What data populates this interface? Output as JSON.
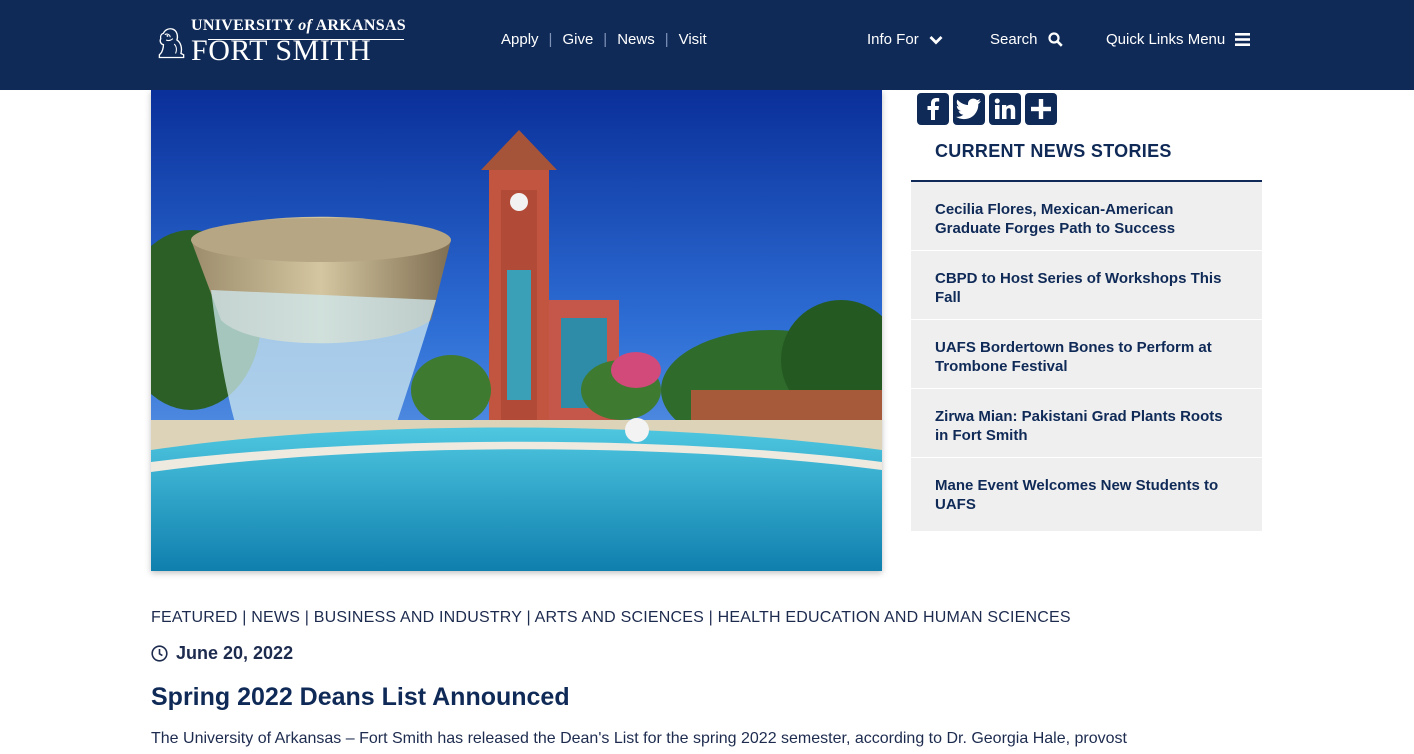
{
  "header": {
    "logo": {
      "line1_a": "UNIVERSITY",
      "line1_b": "of",
      "line1_c": "ARKANSAS",
      "line2": "FORT SMITH"
    },
    "nav": [
      {
        "label": "Apply"
      },
      {
        "label": "Give"
      },
      {
        "label": "News"
      },
      {
        "label": "Visit"
      }
    ],
    "info_for": "Info For",
    "search": "Search",
    "quick_links": "Quick Links Menu"
  },
  "share": [
    "facebook-icon",
    "twitter-icon",
    "linkedin-icon",
    "share-icon"
  ],
  "sidebar": {
    "title": "CURRENT NEWS STORIES",
    "items": [
      {
        "label": "Cecilia Flores, Mexican-American Graduate Forges Path to Success"
      },
      {
        "label": "CBPD to Host Series of Workshops This Fall"
      },
      {
        "label": "UAFS Bordertown Bones to Perform at Trombone Festival"
      },
      {
        "label": "Zirwa Mian: Pakistani Grad Plants Roots in Fort Smith"
      },
      {
        "label": "Mane Event Welcomes New Students to UAFS"
      }
    ]
  },
  "article": {
    "categories": "FEATURED | NEWS | BUSINESS AND INDUSTRY | ARTS AND SCIENCES | HEALTH EDUCATION AND HUMAN SCIENCES",
    "date": "June 20, 2022",
    "title": "Spring 2022 Deans List Announced",
    "body": "The University of Arkansas – Fort Smith has released the Dean's List for the spring 2022 semester, according to Dr. Georgia Hale, provost"
  },
  "colors": {
    "navy": "#0f2a57",
    "sidebar_bg": "#efefef",
    "text": "#1d2b4f"
  }
}
